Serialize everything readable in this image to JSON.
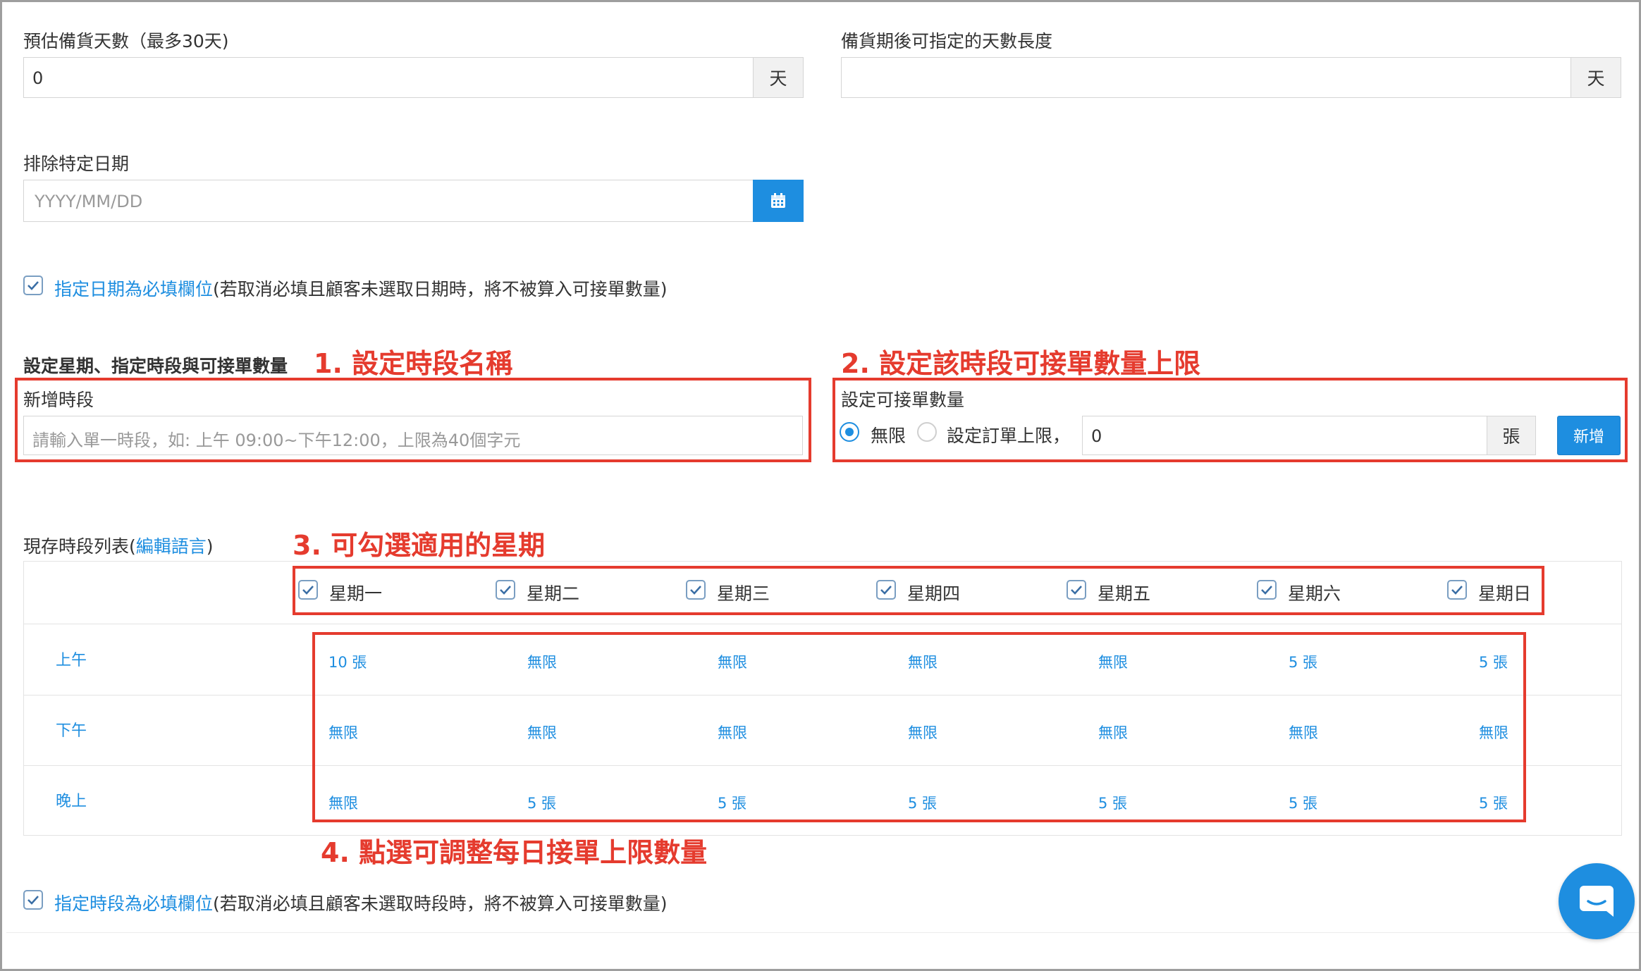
{
  "prep_days": {
    "label": "預估備貨天數（最多30天)",
    "value": "0",
    "unit": "天"
  },
  "after_days": {
    "label": "備貨期後可指定的天數長度",
    "value": "",
    "unit": "天"
  },
  "exclude_dates": {
    "label": "排除特定日期",
    "placeholder": "YYYY/MM/DD",
    "icon": "calendar-icon"
  },
  "date_required": {
    "checked": true,
    "link_text": "指定日期為必填欄位",
    "note": "(若取消必填且顧客未選取日期時，將不被算入可接單數量)"
  },
  "section_title": "設定星期、指定時段與可接單數量",
  "annotations": {
    "step1": "1. 設定時段名稱",
    "step2": "2. 設定該時段可接單數量上限",
    "step3": "3. 可勾選適用的星期",
    "step4": "4. 點選可調整每日接單上限數量"
  },
  "new_slot": {
    "label": "新增時段",
    "placeholder": "請輸入單一時段，如: 上午 09:00~下午12:00，上限為40個字元"
  },
  "capacity": {
    "label": "設定可接單數量",
    "option_unlimited": "無限",
    "option_limit": "設定訂單上限，",
    "selected": "unlimited",
    "value": "0",
    "unit": "張",
    "add_button": "新增"
  },
  "slot_list": {
    "title_prefix": "現存時段列表(",
    "edit_link": "編輯語言",
    "title_suffix": ")"
  },
  "days": [
    "星期一",
    "星期二",
    "星期三",
    "星期四",
    "星期五",
    "星期六",
    "星期日"
  ],
  "rows": [
    {
      "name": "上午",
      "cells": [
        "10 張",
        "無限",
        "無限",
        "無限",
        "無限",
        "5 張",
        "5 張"
      ]
    },
    {
      "name": "下午",
      "cells": [
        "無限",
        "無限",
        "無限",
        "無限",
        "無限",
        "無限",
        "無限"
      ]
    },
    {
      "name": "晚上",
      "cells": [
        "無限",
        "5 張",
        "5 張",
        "5 張",
        "5 張",
        "5 張",
        "5 張"
      ]
    }
  ],
  "slot_required": {
    "checked": true,
    "link_text": "指定時段為必填欄位",
    "note": "(若取消必填且顧客未選取時段時，將不被算入可接單數量)"
  },
  "colors": {
    "accent": "#1e8ee0",
    "annotation": "#e53b2e"
  },
  "chat_icon": "chat-icon"
}
